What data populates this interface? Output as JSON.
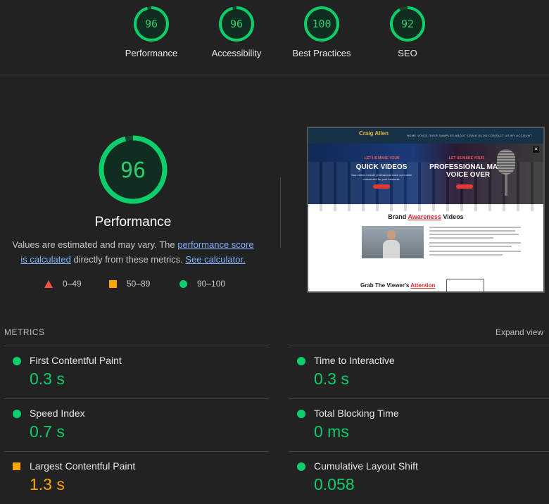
{
  "top_gauges": [
    {
      "score": "96",
      "label": "Performance"
    },
    {
      "score": "96",
      "label": "Accessibility"
    },
    {
      "score": "100",
      "label": "Best Practices"
    },
    {
      "score": "92",
      "label": "SEO"
    }
  ],
  "main": {
    "score": "96",
    "score_fraction": 0.96,
    "title": "Performance",
    "note": {
      "prefix": "Values are estimated and may vary. The ",
      "link1": "performance score is calculated",
      "middle": " directly from these metrics. ",
      "link2": "See calculator."
    },
    "legend": [
      {
        "range": "0–49",
        "shape": "triangle-red"
      },
      {
        "range": "50–89",
        "shape": "square-orange"
      },
      {
        "range": "90–100",
        "shape": "circle-green"
      }
    ]
  },
  "thumbnail": {
    "logo": "Craig Allen",
    "nav": "HOME  VOICE OVER SAMPLES  ABOUT CRAIG  BLOG  CONTACT US  MY ACCOUNT",
    "left_small": "LET US MAKE YOUR",
    "left_big": "QUICK VIDEOS",
    "left_body": "Your videos include professional voice over while customized for your business.",
    "right_small": "LET US MAKE YOUR",
    "right_big_1": "PROFESSIONAL MALE",
    "right_big_2": "VOICE OVER",
    "section1_prefix": "Brand ",
    "section1_highlight": "Awareness",
    "section1_suffix": " Videos",
    "section2_prefix": "Grab The Viewer's ",
    "section2_highlight": "Attention",
    "close": "✕"
  },
  "metrics": {
    "header": "METRICS",
    "expand": "Expand view",
    "items": [
      {
        "name": "First Contentful Paint",
        "value": "0.3 s",
        "rating": "good"
      },
      {
        "name": "Time to Interactive",
        "value": "0.3 s",
        "rating": "good"
      },
      {
        "name": "Speed Index",
        "value": "0.7 s",
        "rating": "good"
      },
      {
        "name": "Total Blocking Time",
        "value": "0 ms",
        "rating": "good"
      },
      {
        "name": "Largest Contentful Paint",
        "value": "1.3 s",
        "rating": "average"
      },
      {
        "name": "Cumulative Layout Shift",
        "value": "0.058",
        "rating": "good"
      }
    ]
  },
  "colors": {
    "good": "#0cce6b",
    "average": "#ffa400",
    "poor": "#ff4e42",
    "background": "#222222"
  }
}
